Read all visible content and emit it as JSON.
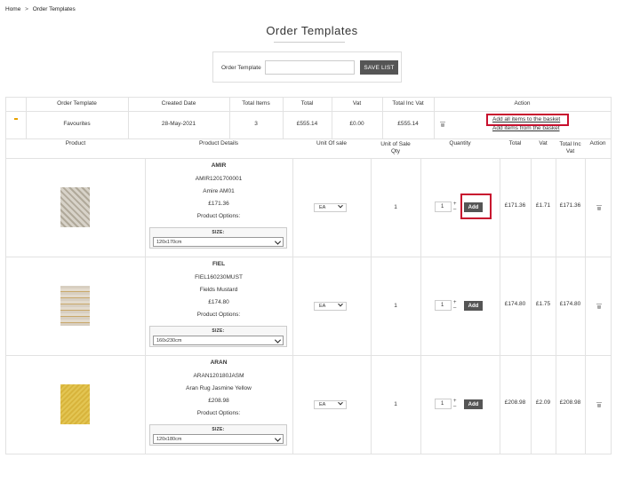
{
  "breadcrumb": {
    "home": "Home",
    "separator": ">",
    "current": "Order Templates"
  },
  "page": {
    "title": "Order Templates"
  },
  "form": {
    "label": "Order Template",
    "input_value": "",
    "input_placeholder": "",
    "save_label": "SAVE LIST"
  },
  "template_table": {
    "headers": [
      "Order Template",
      "Created Date",
      "Total Items",
      "Total",
      "Vat",
      "Total Inc Vat",
      "Action"
    ],
    "row": {
      "name": "Favourites",
      "created": "28-May-2021",
      "total_items": "3",
      "total": "£555.14",
      "vat": "£0.00",
      "total_inc_vat": "£555.14",
      "action_add_all": "Add all items to the basket",
      "action_add_from_basket": "Add items from the basket"
    }
  },
  "product_table": {
    "headers": {
      "product": "Product",
      "details": "Product Details",
      "unit_of_sale": "Unit Of sale",
      "unit_qty": "Unit of Sale Qty",
      "quantity": "Quantity",
      "total": "Total",
      "vat": "Vat",
      "total_inc_vat": "Total Inc Vat",
      "action": "Action"
    },
    "items": [
      {
        "code": "AMIR",
        "sku": "AMIR1201700001",
        "name": "Amire AM01",
        "price": "£171.36",
        "options_label": "Product Options:",
        "size_label": "SIZE:",
        "size_value": "120x170cm",
        "unit_of_sale": "EA",
        "unit_qty": "1",
        "quantity": "1",
        "add_label": "Add",
        "total": "£171.36",
        "vat": "£1.71",
        "total_inc_vat": "£171.36"
      },
      {
        "code": "FIEL",
        "sku": "FIEL160230MUST",
        "name": "Fields Mustard",
        "price": "£174.80",
        "options_label": "Product Options:",
        "size_label": "SIZE:",
        "size_value": "160x230cm",
        "unit_of_sale": "EA",
        "unit_qty": "1",
        "quantity": "1",
        "add_label": "Add",
        "total": "£174.80",
        "vat": "£1.75",
        "total_inc_vat": "£174.80"
      },
      {
        "code": "ARAN",
        "sku": "ARAN120180JASM",
        "name": "Aran Rug Jasmine Yellow",
        "price": "£208.98",
        "options_label": "Product Options:",
        "size_label": "SIZE:",
        "size_value": "120x180cm",
        "unit_of_sale": "EA",
        "unit_qty": "1",
        "quantity": "1",
        "add_label": "Add",
        "total": "£208.98",
        "vat": "£2.09",
        "total_inc_vat": "£208.98"
      }
    ]
  },
  "colors": {
    "highlight": "#c8102e",
    "button": "#555555",
    "toggle": "#e8a200"
  }
}
